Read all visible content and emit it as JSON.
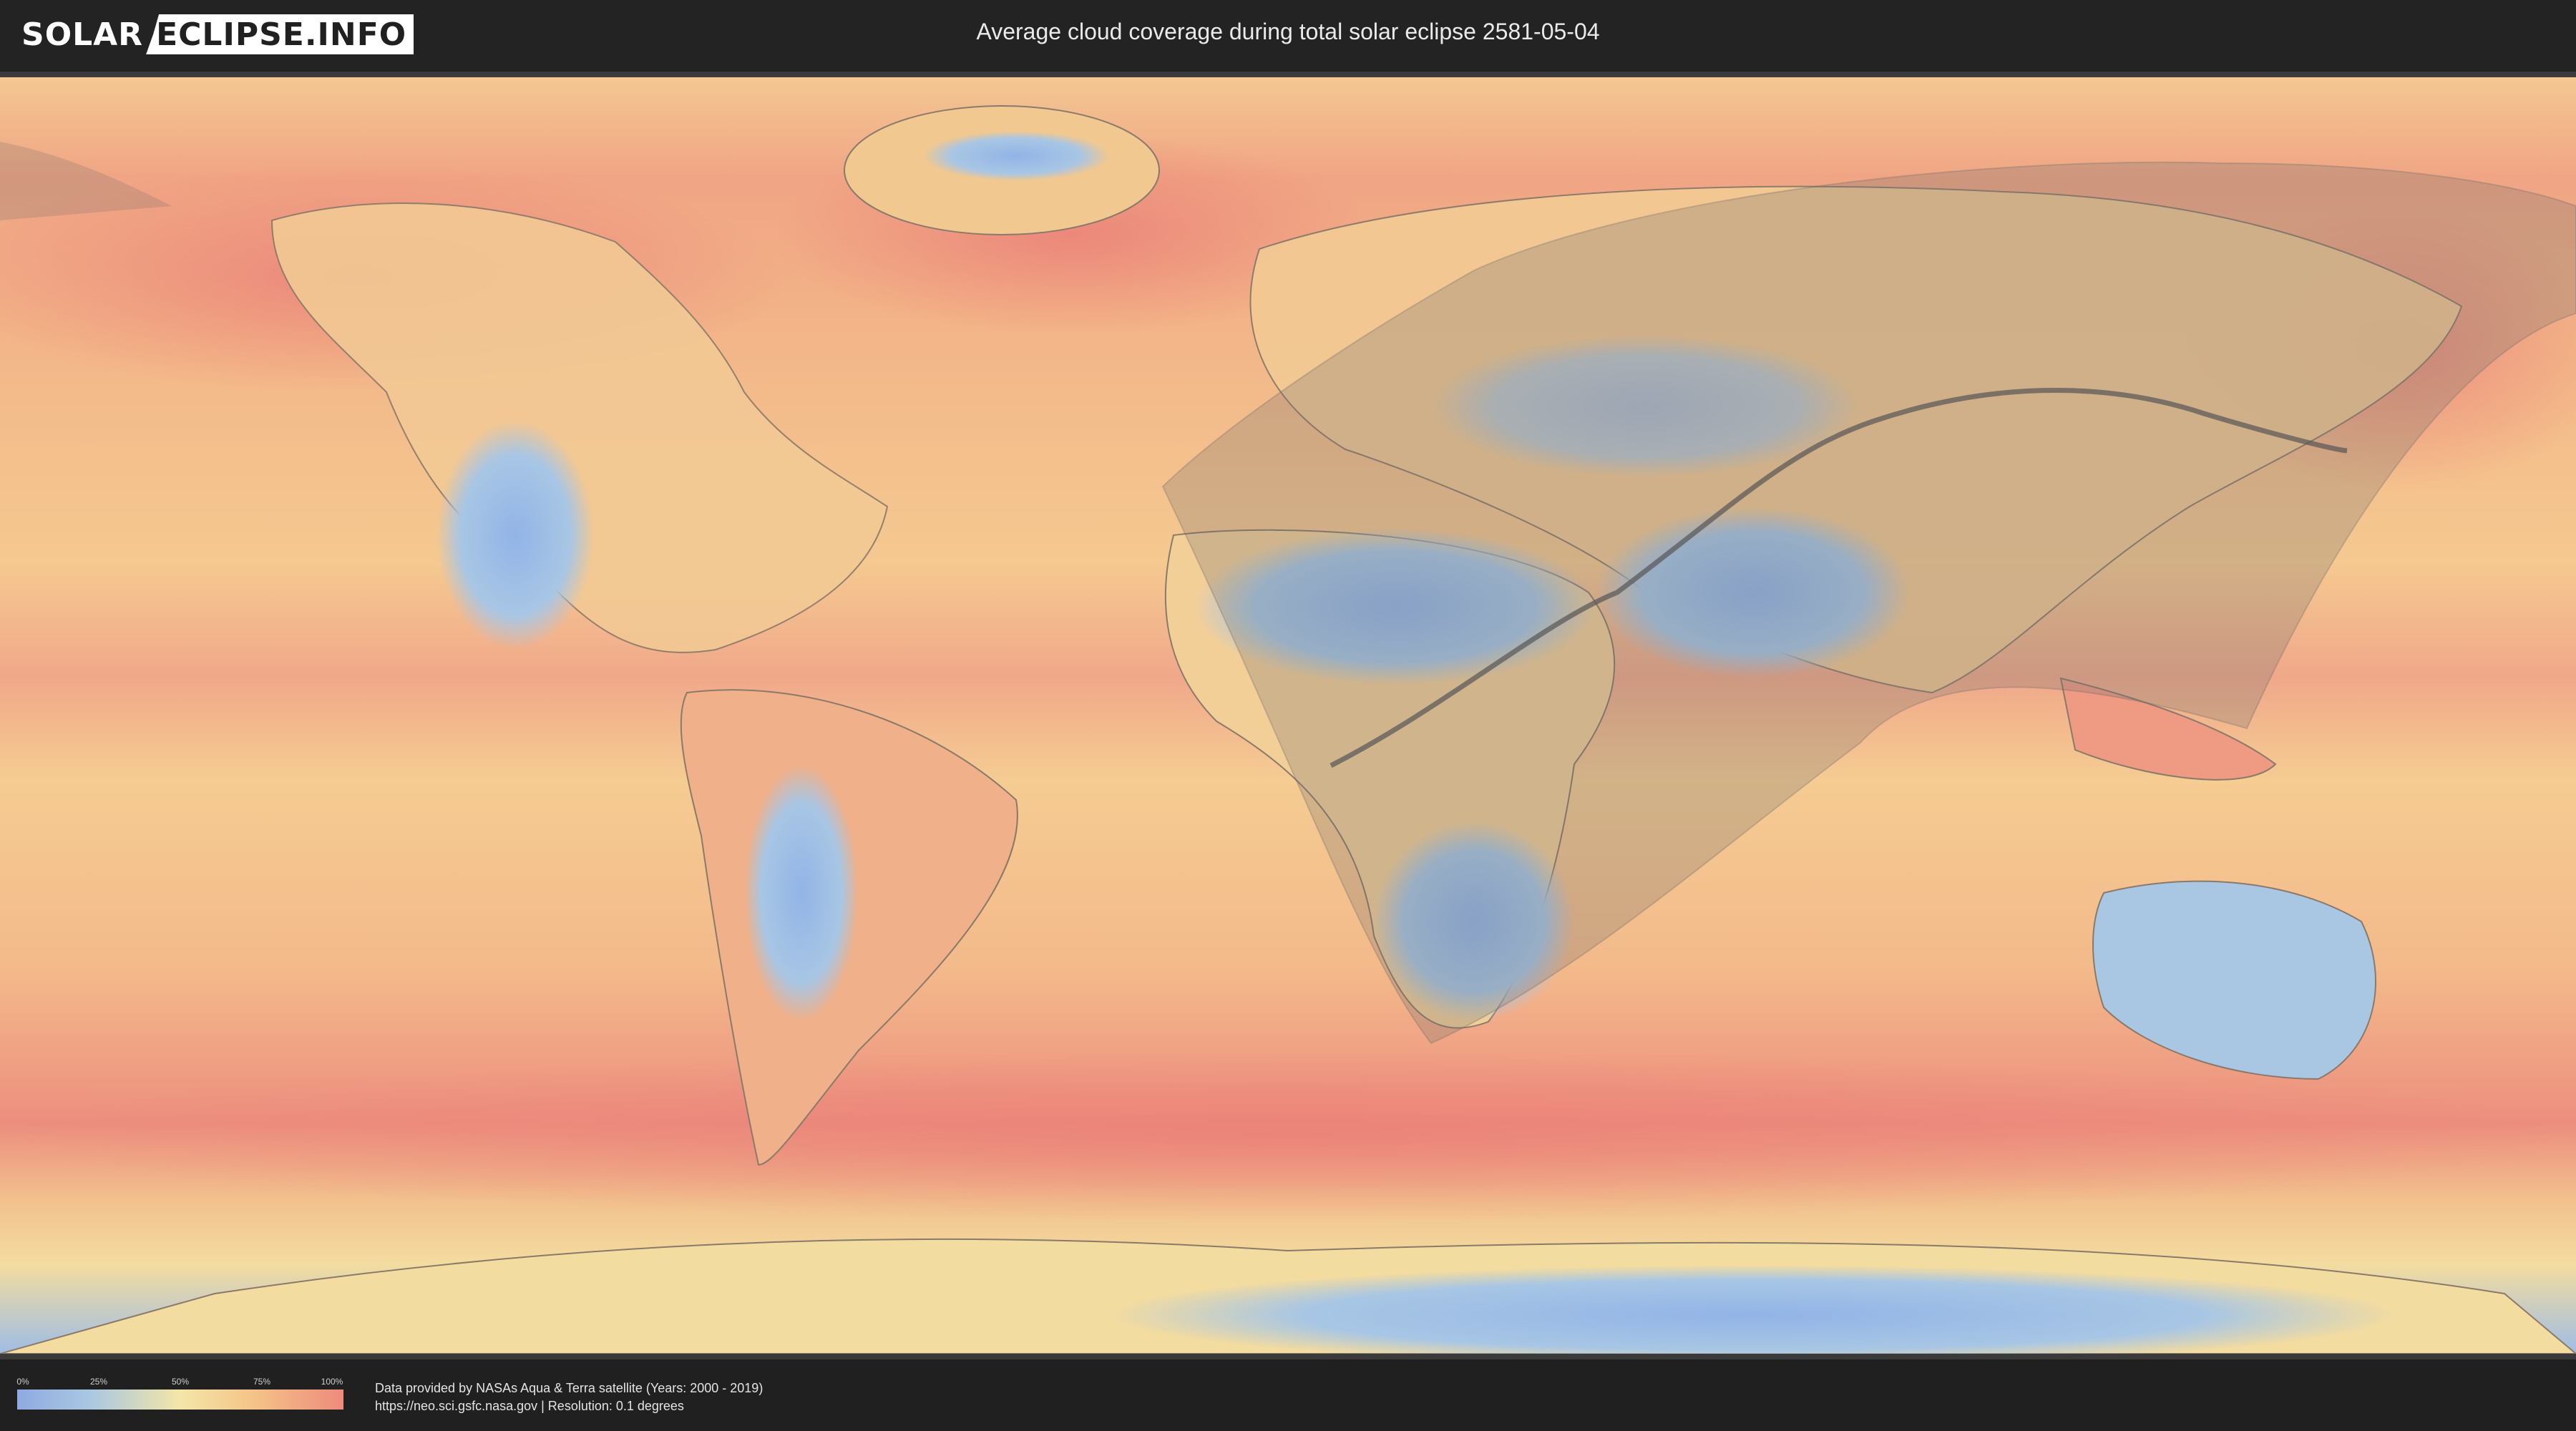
{
  "header": {
    "logo_left": "SOLAR",
    "logo_right": "ECLIPSE.INFO",
    "title": "Average cloud coverage during total solar eclipse 2581-05-04"
  },
  "map": {
    "colors": {
      "ocean_high": "#ec8a7e",
      "ocean_mid": "#f4c58c",
      "clear": "#9fbde4",
      "partial_shadow": "#6b6b6b",
      "central_line": "#555555"
    }
  },
  "legend": {
    "ticks": [
      "0%",
      "25%",
      "50%",
      "75%",
      "100%"
    ],
    "gradient_colors": [
      "#8faae0",
      "#a9c7e2",
      "#f3e6a8",
      "#f4c488",
      "#ee8a7c"
    ]
  },
  "footer": {
    "credit_line_1": "Data provided by NASAs Aqua & Terra satellite (Years: 2000 - 2019)",
    "credit_line_2": "https://neo.sci.gsfc.nasa.gov | Resolution: 0.1 degrees"
  }
}
